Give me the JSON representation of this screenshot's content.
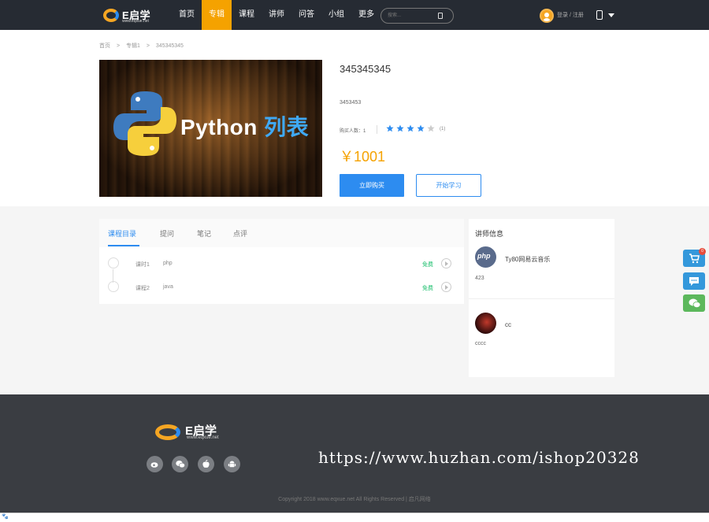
{
  "header": {
    "logo_name": "E启学",
    "logo_url": "www.eqxue.net",
    "nav": [
      "首页",
      "专辑",
      "课程",
      "讲师",
      "问答",
      "小组",
      "更多"
    ],
    "active_nav": 1,
    "search_placeholder": "搜索...",
    "login": "登录",
    "login_sep": "/",
    "register": "注册"
  },
  "breadcrumb": [
    "首页",
    ">",
    "专辑1",
    ">",
    "345345345"
  ],
  "course": {
    "cover_text": "Python",
    "cover_text_zh": "列表",
    "title": "345345345",
    "subtitle": "3453453",
    "buyers_label": "购买人数：1",
    "rating": 4,
    "rating_max": 5,
    "rating_count": "(1)",
    "price": "￥1001",
    "buy_label": "立即购买",
    "learn_label": "开始学习"
  },
  "catalog": {
    "tabs": [
      "课程目录",
      "提问",
      "笔记",
      "点评"
    ],
    "active_tab": 0,
    "lessons": [
      {
        "no": "课时1",
        "name": "php",
        "tag": "免费"
      },
      {
        "no": "课程2",
        "name": "java",
        "tag": "免费"
      }
    ]
  },
  "teacher": {
    "title": "讲师信息",
    "items": [
      {
        "avatar_text": "php",
        "name": "Ty80网易云音乐",
        "desc": "423"
      },
      {
        "avatar_text": "",
        "name": "cc",
        "desc": "cccc"
      }
    ]
  },
  "float": {
    "cart_badge": "0"
  },
  "footer": {
    "logo_name": "E启学",
    "logo_url": "www.eqxue.net",
    "watermark": "https://www.huzhan.com/ishop20328",
    "copyright": "Copyright 2018 www.eqxue.net All Rights Reserved | 启凡网络"
  },
  "colors": {
    "accent": "#2d8cf0",
    "nav_active": "#f5a200",
    "header_bg": "#262b33",
    "footer_bg": "#3a3d42",
    "free": "#19be6b"
  }
}
